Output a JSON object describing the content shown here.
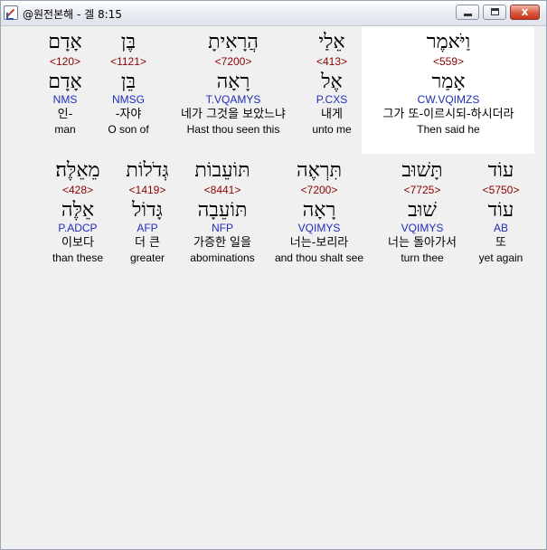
{
  "window": {
    "title": "@원전본해 - 겔 8:15"
  },
  "buttons": {
    "minimize": "",
    "maximize": "",
    "close": "x"
  },
  "row1": [
    {
      "heb": "אָדָם",
      "num": "<120>",
      "root": "אָדָם",
      "morph": "NMS",
      "kor": "인-",
      "eng": "man"
    },
    {
      "heb": "בֶּן",
      "num": "<1121>",
      "root": "בֵּן",
      "morph": "NMSG",
      "kor": "-자야",
      "eng": "O son of"
    },
    {
      "heb": "הֲרָאִיתָ",
      "num": "<7200>",
      "root": "רָאָה",
      "morph": "T.VQAMYS",
      "kor": "네가 그것을 보았느냐",
      "eng": "Hast thou seen this"
    },
    {
      "heb": "אֵלַי",
      "num": "<413>",
      "root": "אֶל",
      "morph": "P.CXS",
      "kor": "내게",
      "eng": "unto me"
    },
    {
      "heb": "וַיֹּאמֶר",
      "num": "<559>",
      "root": "אָמַר",
      "morph": "CW.VQIMZS",
      "kor": "그가 또-이르시되-하시더라",
      "eng": "Then said he"
    }
  ],
  "row2": [
    {
      "heb": "מֵאֵלֶּה׃",
      "num": "<428>",
      "root": "אֵלֶּה",
      "morph": "P.ADCP",
      "kor": "이보다",
      "eng": "than these"
    },
    {
      "heb": "גְּדֹלוֹת",
      "num": "<1419>",
      "root": "גָּדוֹל",
      "morph": "AFP",
      "kor": "더 큰",
      "eng": "greater"
    },
    {
      "heb": "תּוֹעֵבוֹת",
      "num": "<8441>",
      "root": "תּוֹעֵבָה",
      "morph": "NFP",
      "kor": "가증한 일을",
      "eng": "abominations"
    },
    {
      "heb": "תִּרְאֶה",
      "num": "<7200>",
      "root": "רָאָה",
      "morph": "VQIMYS",
      "kor": "너는-보리라",
      "eng": "and thou shalt see"
    },
    {
      "heb": "תָּשׁוּב",
      "num": "<7725>",
      "root": "שׁוּב",
      "morph": "VQIMYS",
      "kor": "너는 돌아가서",
      "eng": "turn thee"
    },
    {
      "heb": "עוֹד",
      "num": "<5750>",
      "root": "עוֹד",
      "morph": "AB",
      "kor": "또",
      "eng": "yet again"
    }
  ]
}
